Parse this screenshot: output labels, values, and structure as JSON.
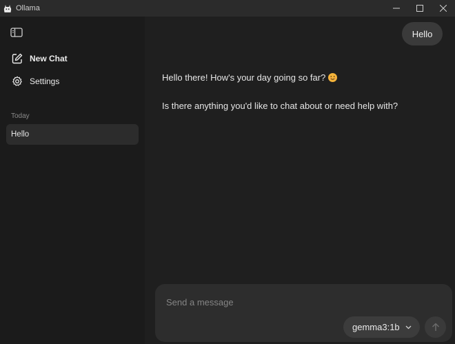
{
  "window": {
    "title": "Ollama"
  },
  "sidebar": {
    "new_chat_label": "New Chat",
    "settings_label": "Settings",
    "section_label": "Today",
    "history": [
      {
        "label": "Hello"
      }
    ]
  },
  "conversation": {
    "user_message": "Hello",
    "assistant_lines": [
      "Hello there! How's your day going so far?",
      "Is there anything you'd like to chat about or need help with?"
    ]
  },
  "composer": {
    "placeholder": "Send a message",
    "model": "gemma3:1b"
  },
  "colors": {
    "background": "#1f1f1f",
    "sidebar": "#1b1b1b",
    "titlebar": "#2b2b2b",
    "bubble": "#3a3a3a",
    "composer": "#2d2d2d",
    "emoji": "#f4b33a"
  },
  "icons": [
    "ollama-logo-icon",
    "minimize-icon",
    "maximize-icon",
    "close-icon",
    "sidebar-toggle-icon",
    "compose-icon",
    "gear-icon",
    "smile-emoji-icon",
    "chevron-down-icon",
    "arrow-up-icon"
  ]
}
